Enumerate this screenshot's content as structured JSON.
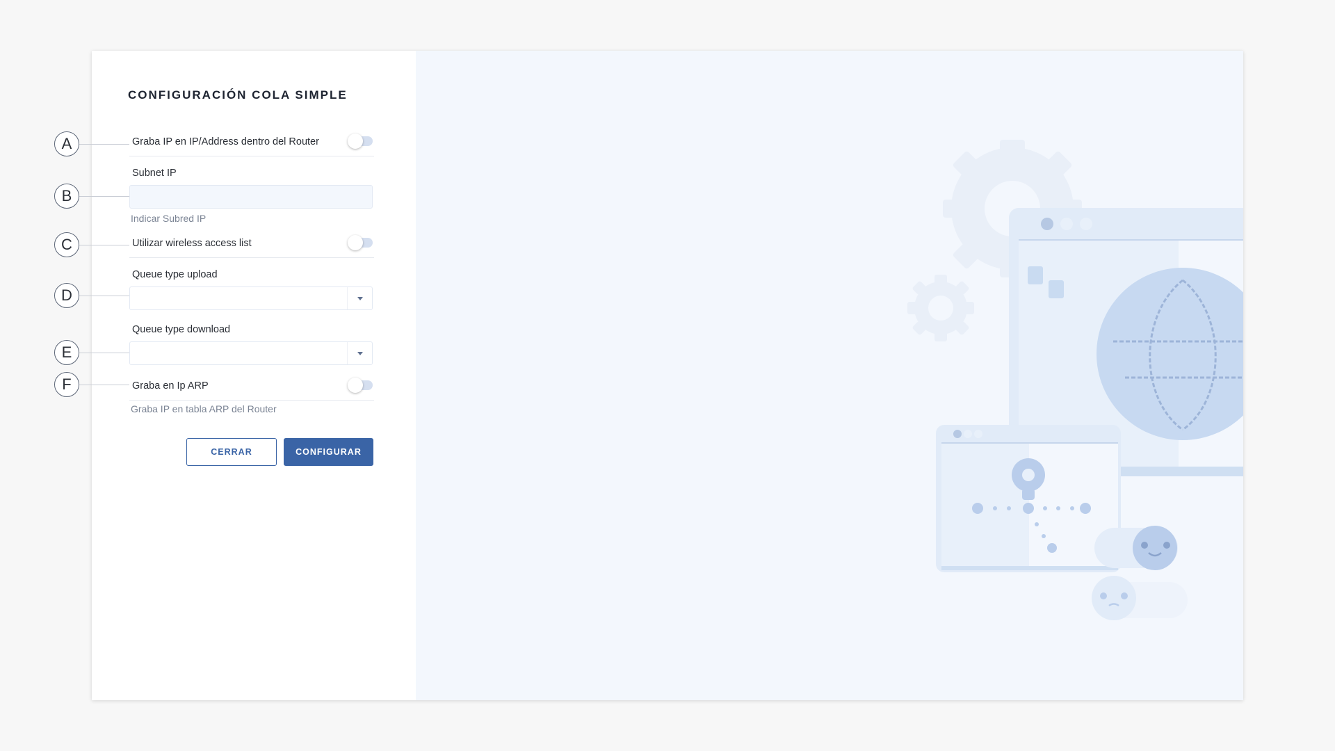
{
  "form": {
    "title": "CONFIGURACIÓN COLA SIMPLE",
    "toggle_ip_address": {
      "label": "Graba IP en IP/Address dentro del Router",
      "checked": false
    },
    "subnet_ip": {
      "label": "Subnet IP",
      "value": "",
      "hint": "Indicar Subred IP"
    },
    "toggle_wireless": {
      "label": "Utilizar wireless access list",
      "checked": false
    },
    "queue_upload": {
      "label": "Queue type upload",
      "value": ""
    },
    "queue_download": {
      "label": "Queue type download",
      "value": ""
    },
    "toggle_arp": {
      "label": "Graba en Ip ARP",
      "checked": false,
      "hint": "Graba IP en tabla ARP del Router"
    },
    "buttons": {
      "close": "CERRAR",
      "configure": "CONFIGURAR"
    }
  },
  "callouts": [
    "A",
    "B",
    "C",
    "D",
    "E",
    "F"
  ],
  "colors": {
    "primary": "#3a64a6",
    "illustration_bg": "#f3f7fd",
    "page_bg": "#f7f7f7",
    "toggle_track": "#d5dff0"
  },
  "icons": [
    "gear-icon",
    "globe-icon",
    "lightbulb-icon",
    "smiley-icon",
    "sad-face-icon",
    "chevron-down-icon"
  ]
}
